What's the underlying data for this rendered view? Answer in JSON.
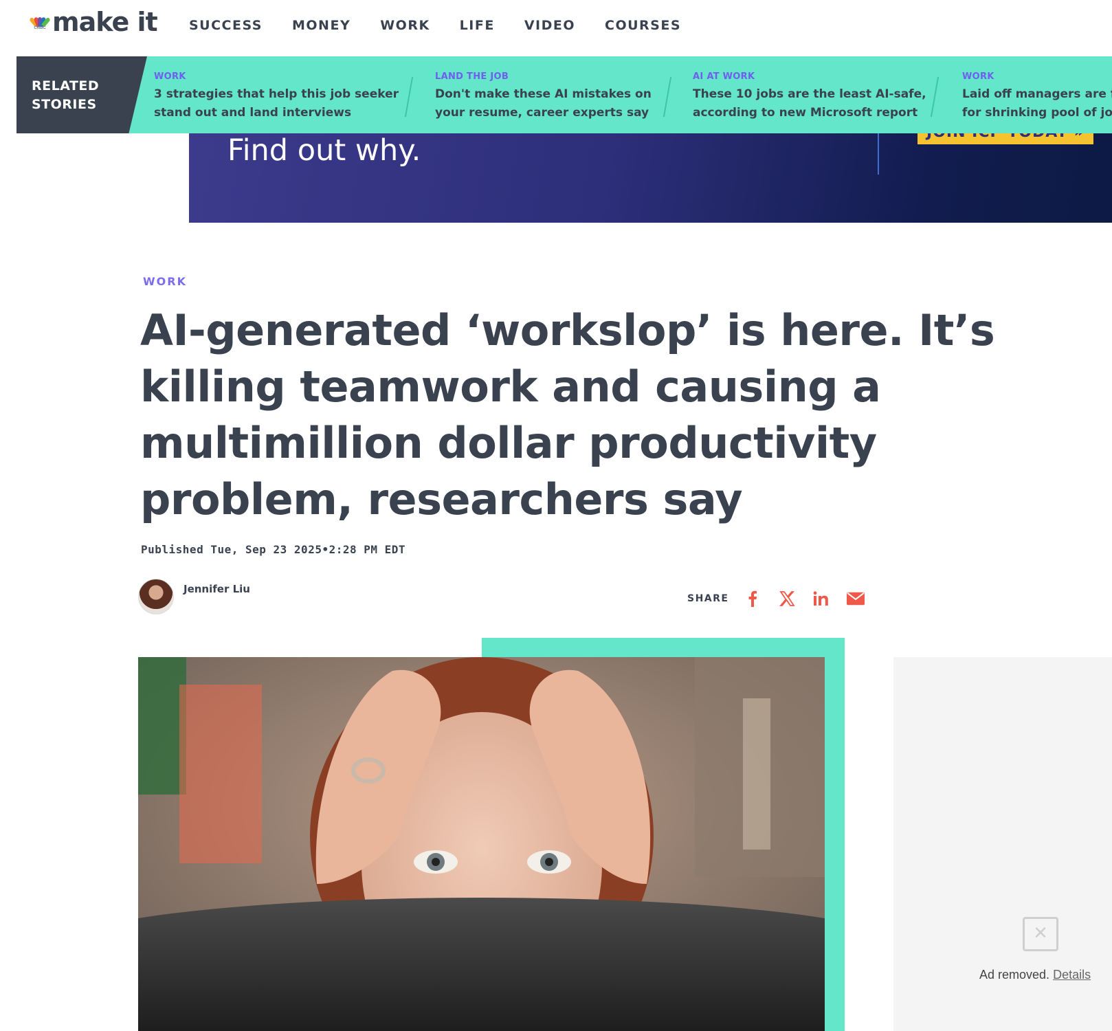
{
  "logo": {
    "brand_small": "CNBC",
    "text": "make it"
  },
  "nav": [
    "SUCCESS",
    "MONEY",
    "WORK",
    "LIFE",
    "VIDEO",
    "COURSES"
  ],
  "related": {
    "label": "RELATED STORIES",
    "stories": [
      {
        "category": "WORK",
        "headline_1": "3 strategies that help this job seeker",
        "headline_2": "stand out and land interviews"
      },
      {
        "category": "LAND THE JOB",
        "headline_1": "Don't make these AI mistakes on",
        "headline_2": "your resume, career experts say"
      },
      {
        "category": "AI AT WORK",
        "headline_1": "These 10 jobs are the least AI-safe,",
        "headline_2": "according to new Microsoft report"
      },
      {
        "category": "WORK",
        "headline_1": "Laid off managers are fi",
        "headline_2": "for shrinking pool of job"
      }
    ]
  },
  "banner": {
    "text": "Find out why.",
    "cta": "JOIN ICP TODAY »"
  },
  "article": {
    "section": "WORK",
    "title": "AI-generated ‘workslop’ is here. It’s killing teamwork and causing a multimillion dollar productivity problem, researchers say",
    "published": "Published Tue, Sep 23 2025•2:28 PM EDT",
    "author": "Jennifer Liu"
  },
  "share": {
    "label": "SHARE",
    "icons": [
      "facebook-icon",
      "x-icon",
      "linkedin-icon",
      "email-icon"
    ],
    "color": "#f0584a"
  },
  "ad": {
    "removed_text": "Ad removed.",
    "details_link": "Details"
  },
  "colors": {
    "accent_teal": "#63e6c9",
    "dark": "#3a4250",
    "category_purple": "#6f5ef0"
  }
}
